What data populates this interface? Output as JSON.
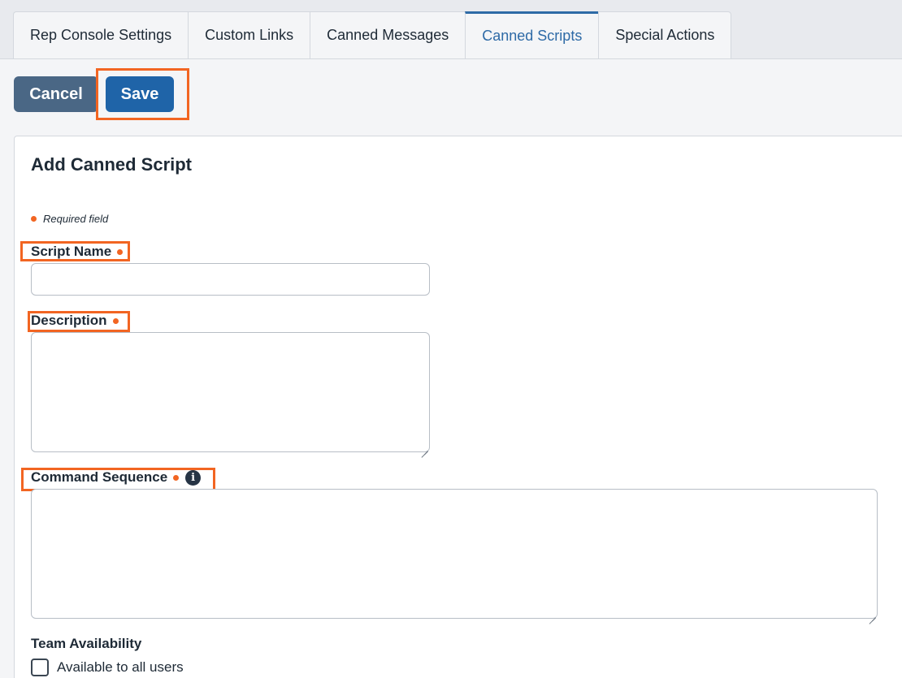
{
  "tabs": [
    {
      "label": "Rep Console Settings",
      "active": false
    },
    {
      "label": "Custom Links",
      "active": false
    },
    {
      "label": "Canned Messages",
      "active": false
    },
    {
      "label": "Canned Scripts",
      "active": true
    },
    {
      "label": "Special Actions",
      "active": false
    }
  ],
  "toolbar": {
    "cancel_label": "Cancel",
    "save_label": "Save"
  },
  "form": {
    "title": "Add Canned Script",
    "required_note": "Required field",
    "script_name": {
      "label": "Script Name",
      "value": "",
      "required": true
    },
    "description": {
      "label": "Description",
      "value": "",
      "required": true
    },
    "command_sequence": {
      "label": "Command Sequence",
      "value": "",
      "required": true,
      "icon": "info-icon"
    },
    "team_availability": {
      "label": "Team Availability",
      "all_users_label": "Available to all users",
      "all_users_checked": false
    }
  },
  "colors": {
    "accent": "#2e6aa6",
    "save_button": "#1f64a8",
    "cancel_button": "#4a6785",
    "required_dot": "#f26522",
    "highlight": "#f26522"
  }
}
